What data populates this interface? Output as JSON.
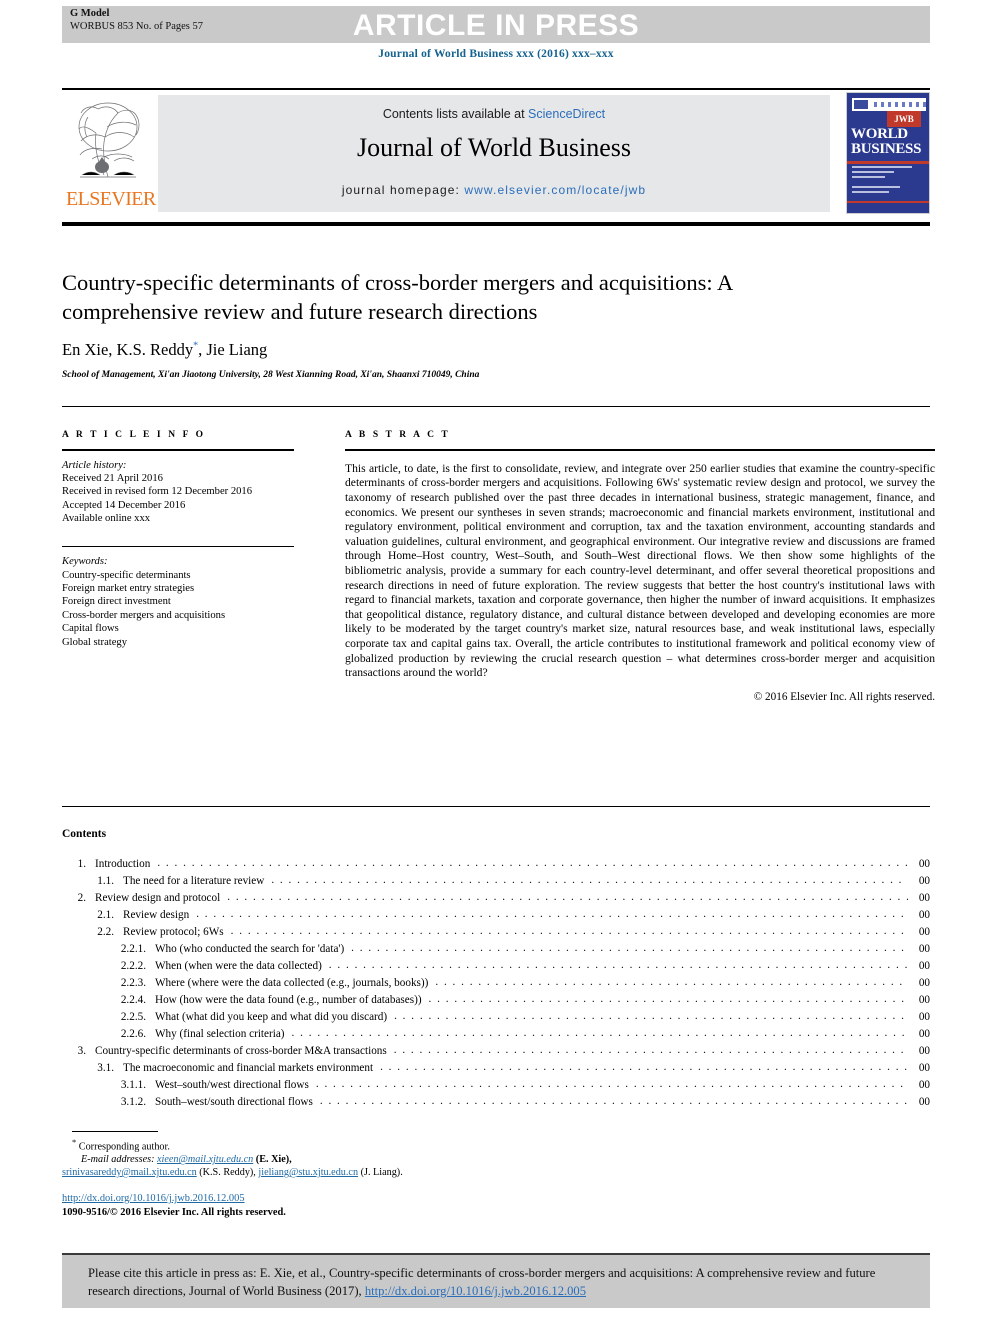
{
  "header": {
    "g_model": "G Model",
    "manuscript_id": "WORBUS 853 No. of Pages 57",
    "article_in_press": "ARTICLE IN PRESS",
    "journal_citation": "Journal of World Business xxx (2016) xxx–xxx"
  },
  "masthead": {
    "publisher_name": "ELSEVIER",
    "contents_prefix": "Contents lists available at ",
    "contents_link": "ScienceDirect",
    "journal_name": "Journal of World Business",
    "homepage_prefix": "journal homepage: ",
    "homepage_link": "www.elsevier.com/locate/jwb",
    "cover_title_line1": "WORLD",
    "cover_title_line2": "BUSINESS",
    "cover_badge": "JWB"
  },
  "article": {
    "title": "Country-specific determinants of cross-border mergers and acquisitions: A comprehensive review and future research directions",
    "authors_pre": "En Xie, K.S. Reddy",
    "authors_marker": "*",
    "authors_post": ", Jie Liang",
    "affiliation": "School of Management, Xi'an Jiaotong University, 28 West Xianning Road, Xi'an, Shaanxi 710049, China"
  },
  "article_info": {
    "heading": "A R T I C L E   I N F O",
    "history_label": "Article history:",
    "history": [
      "Received 21 April 2016",
      "Received in revised form 12 December 2016",
      "Accepted 14 December 2016",
      "Available online xxx"
    ],
    "keywords_label": "Keywords:",
    "keywords": [
      "Country-specific determinants",
      "Foreign market entry strategies",
      "Foreign direct investment",
      "Cross-border mergers and acquisitions",
      "Capital flows",
      "Global strategy"
    ]
  },
  "abstract": {
    "heading": "A B S T R A C T",
    "text": "This article, to date, is the first to consolidate, review, and integrate over 250 earlier studies that examine the country-specific determinants of cross-border mergers and acquisitions. Following 6Ws' systematic review design and protocol, we survey the taxonomy of research published over the past three decades in international business, strategic management, finance, and economics. We present our syntheses in seven strands; macroeconomic and financial markets environment, institutional and regulatory environment, political environment and corruption, tax and the taxation environment, accounting standards and valuation guidelines, cultural environment, and geographical environment. Our integrative review and discussions are framed through Home–Host country, West–South, and South–West directional flows. We then show some highlights of the bibliometric analysis, provide a summary for each country-level determinant, and offer several theoretical propositions and research directions in need of future exploration. The review suggests that better the host country's institutional laws with regard to financial markets, taxation and corporate governance, then higher the number of inward acquisitions. It emphasizes that geopolitical distance, regulatory distance, and cultural distance between developed and developing economies are more likely to be moderated by the target country's market size, natural resources base, and weak institutional laws, especially corporate tax and capital gains tax. Overall, the article contributes to institutional framework and political economy view of globalized production by reviewing the crucial research question – what determines cross-border merger and acquisition transactions around the world?",
    "copyright": "© 2016 Elsevier Inc. All rights reserved."
  },
  "contents": {
    "heading": "Contents",
    "entries": [
      {
        "level": 1,
        "num": "1.",
        "label": "Introduction",
        "page": "00"
      },
      {
        "level": 2,
        "num": "1.1.",
        "label": "The need for a literature review",
        "page": "00"
      },
      {
        "level": 1,
        "num": "2.",
        "label": "Review design and protocol",
        "page": "00"
      },
      {
        "level": 2,
        "num": "2.1.",
        "label": "Review design",
        "page": "00"
      },
      {
        "level": 2,
        "num": "2.2.",
        "label": "Review protocol; 6Ws",
        "page": "00"
      },
      {
        "level": 3,
        "num": "2.2.1.",
        "label": "Who (who conducted the search for 'data')",
        "page": "00"
      },
      {
        "level": 3,
        "num": "2.2.2.",
        "label": "When (when were the data collected)",
        "page": "00"
      },
      {
        "level": 3,
        "num": "2.2.3.",
        "label": "Where (where were the data collected (e.g., journals, books))",
        "page": "00"
      },
      {
        "level": 3,
        "num": "2.2.4.",
        "label": "How (how were the data found (e.g., number of databases))",
        "page": "00"
      },
      {
        "level": 3,
        "num": "2.2.5.",
        "label": "What (what did you keep and what did you discard)",
        "page": "00"
      },
      {
        "level": 3,
        "num": "2.2.6.",
        "label": "Why (final selection criteria)",
        "page": "00"
      },
      {
        "level": 1,
        "num": "3.",
        "label": "Country-specific determinants of cross-border M&A transactions",
        "page": "00"
      },
      {
        "level": 2,
        "num": "3.1.",
        "label": "The macroeconomic and financial markets environment",
        "page": "00"
      },
      {
        "level": 3,
        "num": "3.1.1.",
        "label": "West–south/west directional flows",
        "page": "00"
      },
      {
        "level": 3,
        "num": "3.1.2.",
        "label": "South–west/south directional flows",
        "page": "00"
      }
    ]
  },
  "footnotes": {
    "corresponding_marker": "*",
    "corresponding_text": "Corresponding author.",
    "email_label": "E-mail addresses:",
    "emails": [
      {
        "address": "xieen@mail.xjtu.edu.cn",
        "person": "(E. Xie),"
      },
      {
        "address": "srinivasareddy@mail.xjtu.edu.cn",
        "person": "(K.S.  Reddy),"
      },
      {
        "address": "jieliang@stu.xjtu.edu.cn",
        "person": "(J. Liang)."
      }
    ],
    "doi_url": "http://dx.doi.org/10.1016/j.jwb.2016.12.005",
    "issn_line": "1090-9516/© 2016 Elsevier Inc. All rights reserved."
  },
  "citation_box": {
    "text_before_link": "Please cite this article in press as: E. Xie, et al., Country-specific determinants of cross-border mergers and acquisitions: A comprehensive review and future research directions, Journal of World Business (2017), ",
    "link": "http://dx.doi.org/10.1016/j.jwb.2016.12.005"
  },
  "colors": {
    "aip_band": "#c9c9c9",
    "link_blue": "#2a6ebb",
    "cite_blue": "#13628f",
    "elsevier_orange": "#e87722",
    "masthead_grey": "#e6e7e8",
    "cover_blue": "#2b3a8f",
    "cover_red": "#c0392b"
  }
}
